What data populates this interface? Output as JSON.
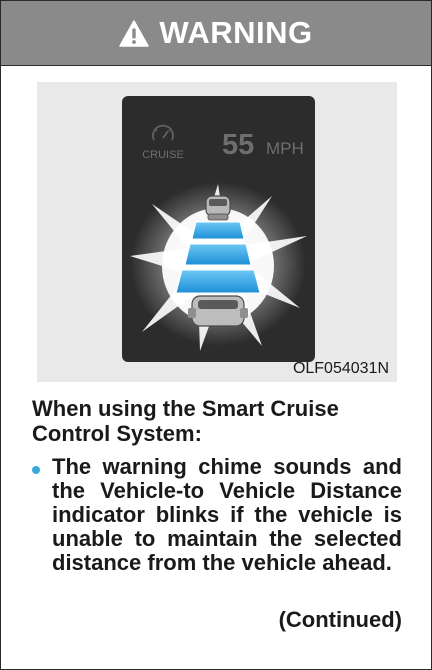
{
  "header": {
    "title": "WARNING",
    "icon": "warning-triangle-icon",
    "background": "#8a8a8a"
  },
  "figure": {
    "code": "OLF054031N",
    "cluster": {
      "cruise_label": "CRUISE",
      "cruise_icon": "cruise-speedometer-icon",
      "speed_value": "55",
      "speed_unit": "MPH",
      "distance_bars_lit": 3,
      "distance_bar_color": "#2a9fe0",
      "vehicle_ahead_icon": "car-icon",
      "own_vehicle_icon": "car-icon"
    }
  },
  "content": {
    "intro": "When using the Smart Cruise Control System:",
    "bullets": [
      {
        "text": "The warning chime sounds and the Vehicle-to Vehicle Distance indicator blinks if the vehicle is unable to main­tain the selected distance from the vehicle ahead."
      }
    ],
    "bullet_color": "#3aa8df",
    "continued": "(Continued)"
  }
}
